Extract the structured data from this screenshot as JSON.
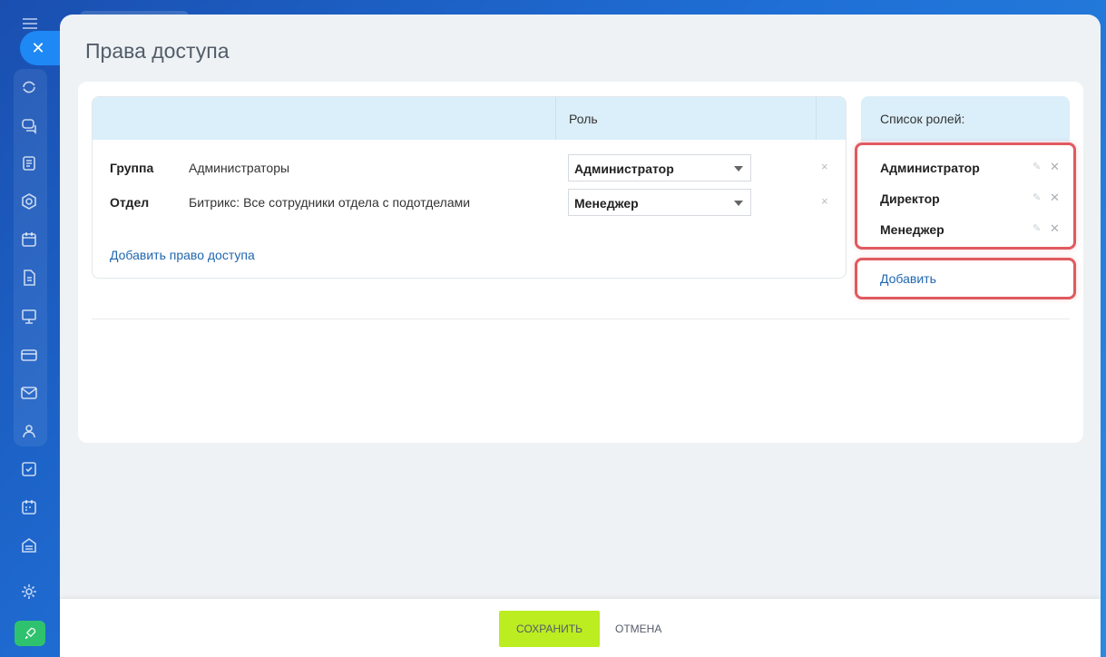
{
  "panel": {
    "title": "Права доступа",
    "close_glyph": "✕"
  },
  "access_table": {
    "role_header": "Роль",
    "rows": [
      {
        "type": "Группа",
        "name": "Администраторы",
        "role": "Администратор",
        "remove": "×"
      },
      {
        "type": "Отдел",
        "name": "Битрикс: Все сотрудники отдела с подотделами",
        "role": "Менеджер",
        "remove": "×"
      }
    ],
    "add_link": "Добавить право доступа"
  },
  "roles": {
    "header": "Список ролей:",
    "items": [
      {
        "name": "Администратор",
        "edit_icon": "pencil-icon",
        "delete_icon": "close-icon"
      },
      {
        "name": "Директор",
        "edit_icon": "pencil-icon",
        "delete_icon": "close-icon"
      },
      {
        "name": "Менеджер",
        "edit_icon": "pencil-icon",
        "delete_icon": "close-icon"
      }
    ],
    "add_label": "Добавить",
    "highlight_color": "#e05a60"
  },
  "footer": {
    "save_label": "СОХРАНИТЬ",
    "cancel_label": "ОТМЕНА",
    "save_color": "#bbed21"
  },
  "sidebar": {
    "icons": [
      "sync-icon",
      "chat-icon",
      "feed-icon",
      "hexagon-icon",
      "calendar-icon",
      "document-icon",
      "presentation-icon",
      "card-icon",
      "mail-icon",
      "users-icon",
      "tasks-icon",
      "planner-icon",
      "store-icon",
      "settings-icon",
      "rocket-icon"
    ]
  }
}
